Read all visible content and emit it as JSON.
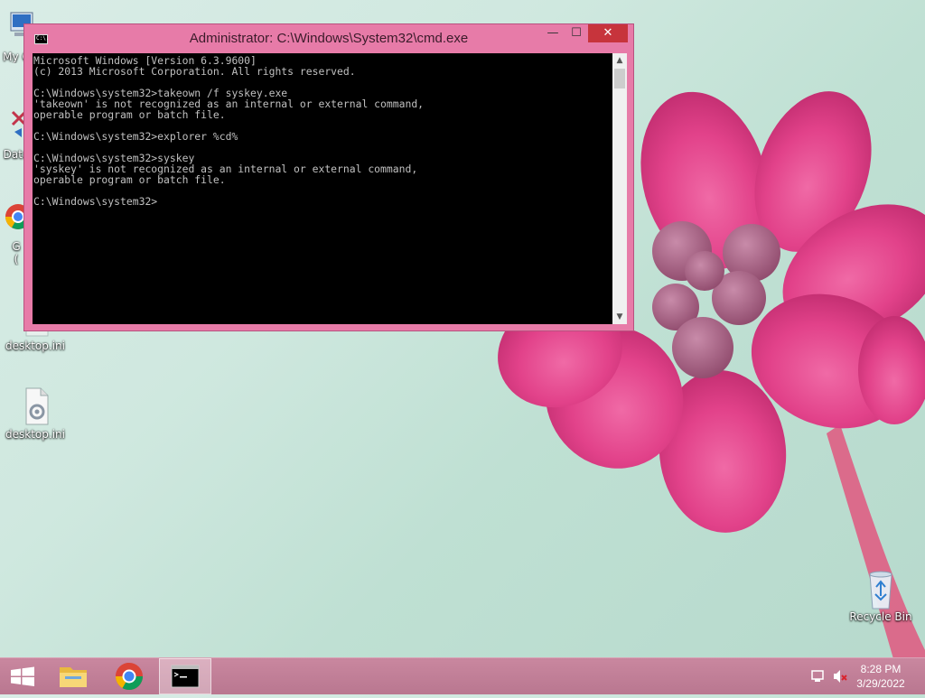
{
  "window": {
    "title": "Administrator: C:\\Windows\\System32\\cmd.exe",
    "icon_text": "C:\\.",
    "minimize_glyph": "—",
    "maximize_glyph": "☐",
    "close_glyph": "✕",
    "console_text": "Microsoft Windows [Version 6.3.9600]\n(c) 2013 Microsoft Corporation. All rights reserved.\n\nC:\\Windows\\system32>takeown /f syskey.exe\n'takeown' is not recognized as an internal or external command,\noperable program or batch file.\n\nC:\\Windows\\system32>explorer %cd%\n\nC:\\Windows\\system32>syskey\n'syskey' is not recognized as an internal or external command,\noperable program or batch file.\n\nC:\\Windows\\system32>"
  },
  "desktop": {
    "icons": [
      {
        "label": "My C",
        "icon": "computer-icon"
      },
      {
        "label": "Data",
        "icon": "data-icon"
      },
      {
        "label": "G\n(",
        "icon": "chrome-icon"
      },
      {
        "label": "desktop.ini",
        "icon": "settings-file-icon"
      },
      {
        "label": "desktop.ini",
        "icon": "settings-file-icon"
      },
      {
        "label": "Recycle Bin",
        "icon": "recycle-bin-icon"
      }
    ]
  },
  "taskbar": {
    "items": [
      {
        "icon": "windows-start-icon"
      },
      {
        "icon": "file-explorer-icon"
      },
      {
        "icon": "chrome-icon"
      },
      {
        "icon": "cmd-icon",
        "active": true
      }
    ],
    "tray": {
      "network_icon": "network-icon",
      "volume_icon": "volume-muted-icon",
      "time": "8:28 PM",
      "date": "3/29/2022"
    }
  },
  "colors": {
    "title_bar": "#e77ba8",
    "close_button": "#c7343c",
    "console_bg": "#000000",
    "console_fg": "#c0c0c0",
    "taskbar": "#c9879f"
  }
}
